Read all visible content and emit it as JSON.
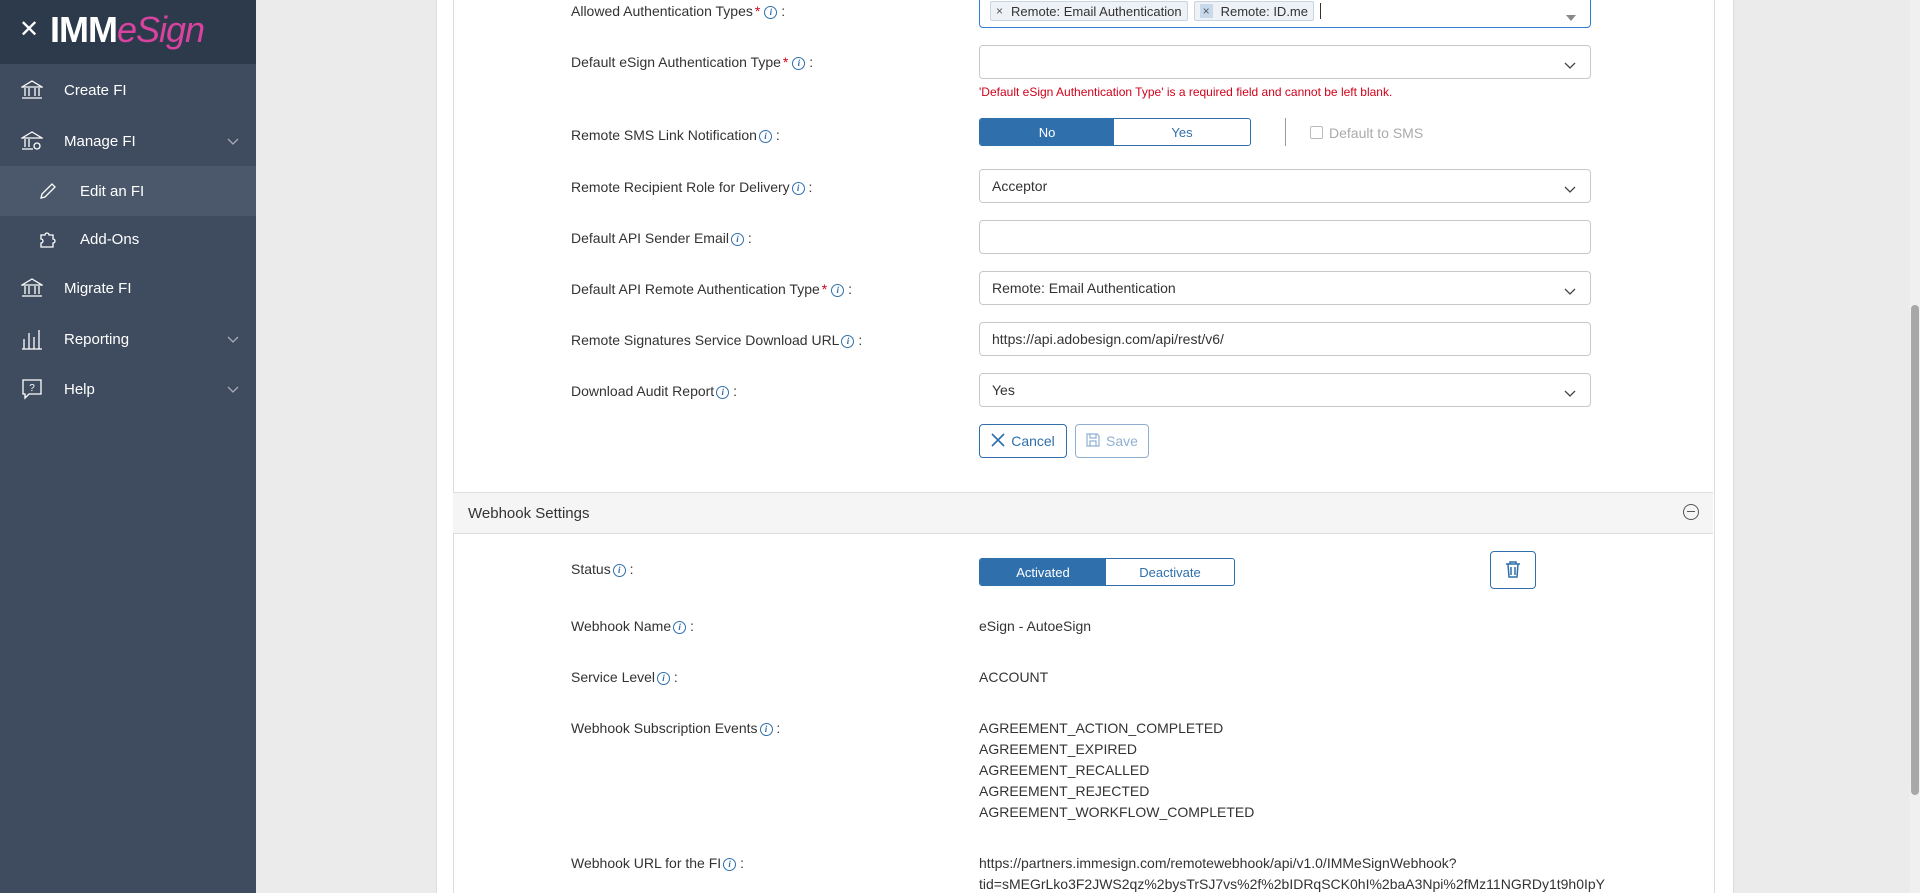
{
  "sidebar": {
    "logo_imm": "IMM",
    "logo_esign": "eSign",
    "items": [
      {
        "label": "Create FI"
      },
      {
        "label": "Manage FI"
      },
      {
        "label": "Edit an FI"
      },
      {
        "label": "Add-Ons"
      },
      {
        "label": "Migrate FI"
      },
      {
        "label": "Reporting"
      },
      {
        "label": "Help"
      }
    ]
  },
  "form": {
    "allowed_auth": {
      "label": "Allowed Authentication Types",
      "tags": [
        "Remote: Email Authentication",
        "Remote: ID.me"
      ]
    },
    "default_esign_auth": {
      "label": "Default eSign Authentication Type",
      "value": "",
      "error": "'Default eSign Authentication Type' is a required field and cannot be left blank."
    },
    "sms_link": {
      "label": "Remote SMS Link Notification",
      "no": "No",
      "yes": "Yes",
      "default_sms": "Default to SMS"
    },
    "recipient_role": {
      "label": "Remote Recipient Role for Delivery",
      "value": "Acceptor"
    },
    "api_sender_email": {
      "label": "Default API Sender Email",
      "value": ""
    },
    "api_remote_auth": {
      "label": "Default API Remote Authentication Type",
      "value": "Remote: Email Authentication"
    },
    "download_url": {
      "label": "Remote Signatures Service Download URL",
      "value": "https://api.adobesign.com/api/rest/v6/"
    },
    "audit_report": {
      "label": "Download Audit Report",
      "value": "Yes"
    },
    "cancel_label": "Cancel",
    "save_label": "Save"
  },
  "webhook": {
    "title": "Webhook Settings",
    "status_label": "Status",
    "activated": "Activated",
    "deactivate": "Deactivate",
    "name_label": "Webhook Name",
    "name_value": "eSign - AutoeSign",
    "service_label": "Service Level",
    "service_value": "ACCOUNT",
    "events_label": "Webhook Subscription Events",
    "events": [
      "AGREEMENT_ACTION_COMPLETED",
      "AGREEMENT_EXPIRED",
      "AGREEMENT_RECALLED",
      "AGREEMENT_REJECTED",
      "AGREEMENT_WORKFLOW_COMPLETED"
    ],
    "url_label": "Webhook URL for the FI",
    "url_line1": "https://partners.immesign.com/remotewebhook/api/v1.0/IMMeSignWebhook?",
    "url_line2": "tid=sMEGrLko3F2JWS2qz%2bysTrSJ7vs%2f%2bIDRqSCK0hI%2baA3Npi%2fMz11NGRDy1t9h0IpY"
  }
}
